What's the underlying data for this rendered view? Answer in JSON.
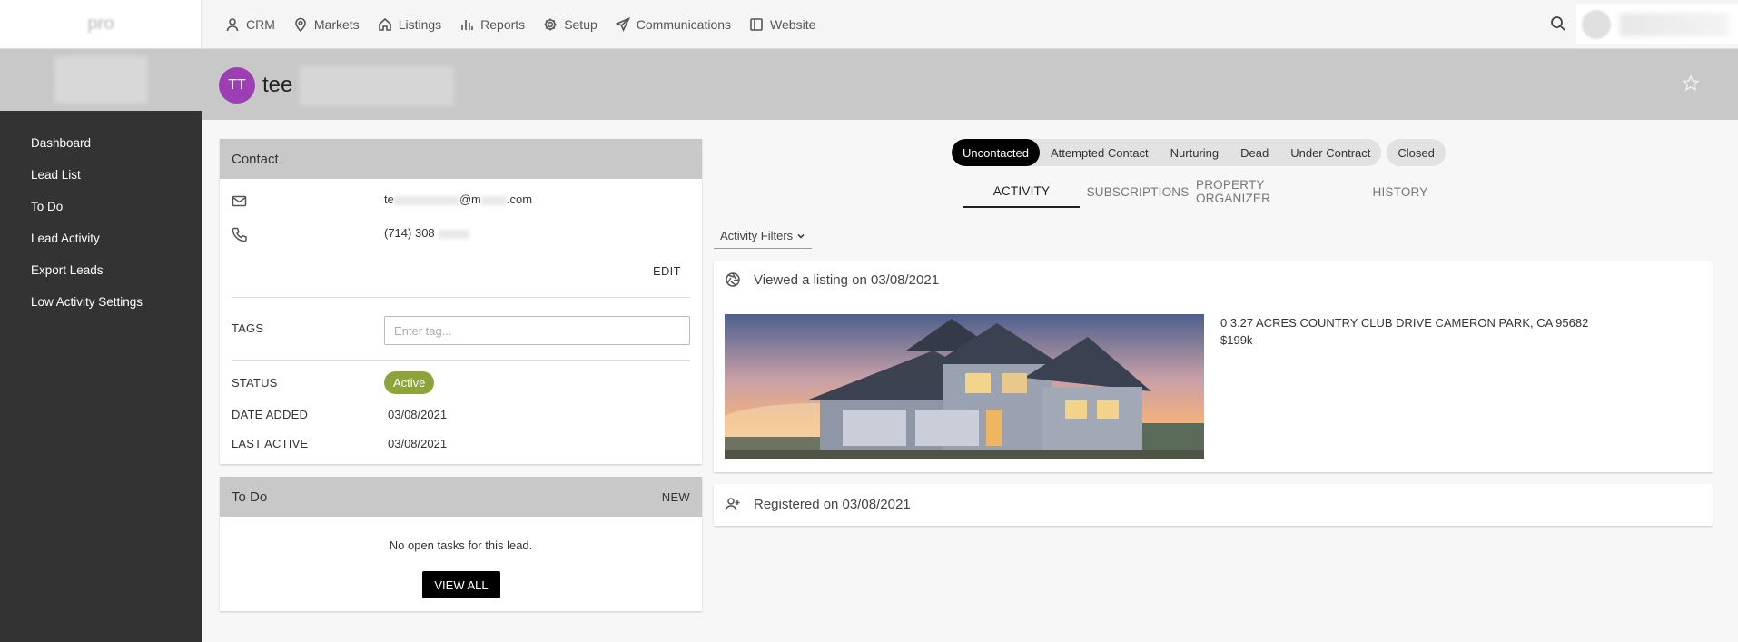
{
  "topbar": {
    "logo": "pro",
    "nav": [
      {
        "label": "CRM",
        "icon": "user-icon"
      },
      {
        "label": "Markets",
        "icon": "map-pin-icon"
      },
      {
        "label": "Listings",
        "icon": "home-icon"
      },
      {
        "label": "Reports",
        "icon": "bar-chart-icon"
      },
      {
        "label": "Setup",
        "icon": "gear-icon"
      },
      {
        "label": "Communications",
        "icon": "send-icon"
      },
      {
        "label": "Website",
        "icon": "browser-icon"
      }
    ]
  },
  "sidebar": {
    "items": [
      {
        "label": "Dashboard"
      },
      {
        "label": "Lead List"
      },
      {
        "label": "To Do"
      },
      {
        "label": "Lead Activity"
      },
      {
        "label": "Export Leads"
      },
      {
        "label": "Low Activity Settings"
      }
    ]
  },
  "lead": {
    "initials": "TT",
    "name": "tee",
    "avatar_color": "#9c3fb5"
  },
  "contact": {
    "title": "Contact",
    "email_prefix": "te",
    "email_mid": "@m",
    "email_suffix": ".com",
    "phone": "(714) 308",
    "edit_label": "EDIT",
    "tags_label": "TAGS",
    "tags_placeholder": "Enter tag...",
    "status_label": "STATUS",
    "status_value": "Active",
    "status_color": "#8ea43a",
    "date_added_label": "DATE ADDED",
    "date_added": "03/08/2021",
    "last_active_label": "LAST ACTIVE",
    "last_active": "03/08/2021"
  },
  "todo": {
    "title": "To Do",
    "new_label": "NEW",
    "empty_text": "No open tasks for this lead.",
    "view_all_label": "VIEW ALL"
  },
  "pipeline": {
    "stages": [
      {
        "label": "Uncontacted",
        "active": true
      },
      {
        "label": "Attempted Contact",
        "active": false
      },
      {
        "label": "Nurturing",
        "active": false
      },
      {
        "label": "Dead",
        "active": false
      },
      {
        "label": "Under Contract",
        "active": false
      }
    ],
    "closed_label": "Closed"
  },
  "tabs": [
    {
      "label": "ACTIVITY",
      "active": true
    },
    {
      "label": "SUBSCRIPTIONS",
      "active": false
    },
    {
      "label": "PROPERTY ORGANIZER",
      "active": false
    },
    {
      "label": "HISTORY",
      "active": false
    }
  ],
  "activity": {
    "filters_label": "Activity Filters",
    "items": [
      {
        "title": "Viewed a listing on 03/08/2021",
        "icon": "aperture-icon",
        "address": "0 3.27 ACRES COUNTRY CLUB DRIVE CAMERON PARK, CA 95682",
        "price": "$199k"
      },
      {
        "title": "Registered on 03/08/2021",
        "icon": "user-plus-icon"
      }
    ]
  }
}
